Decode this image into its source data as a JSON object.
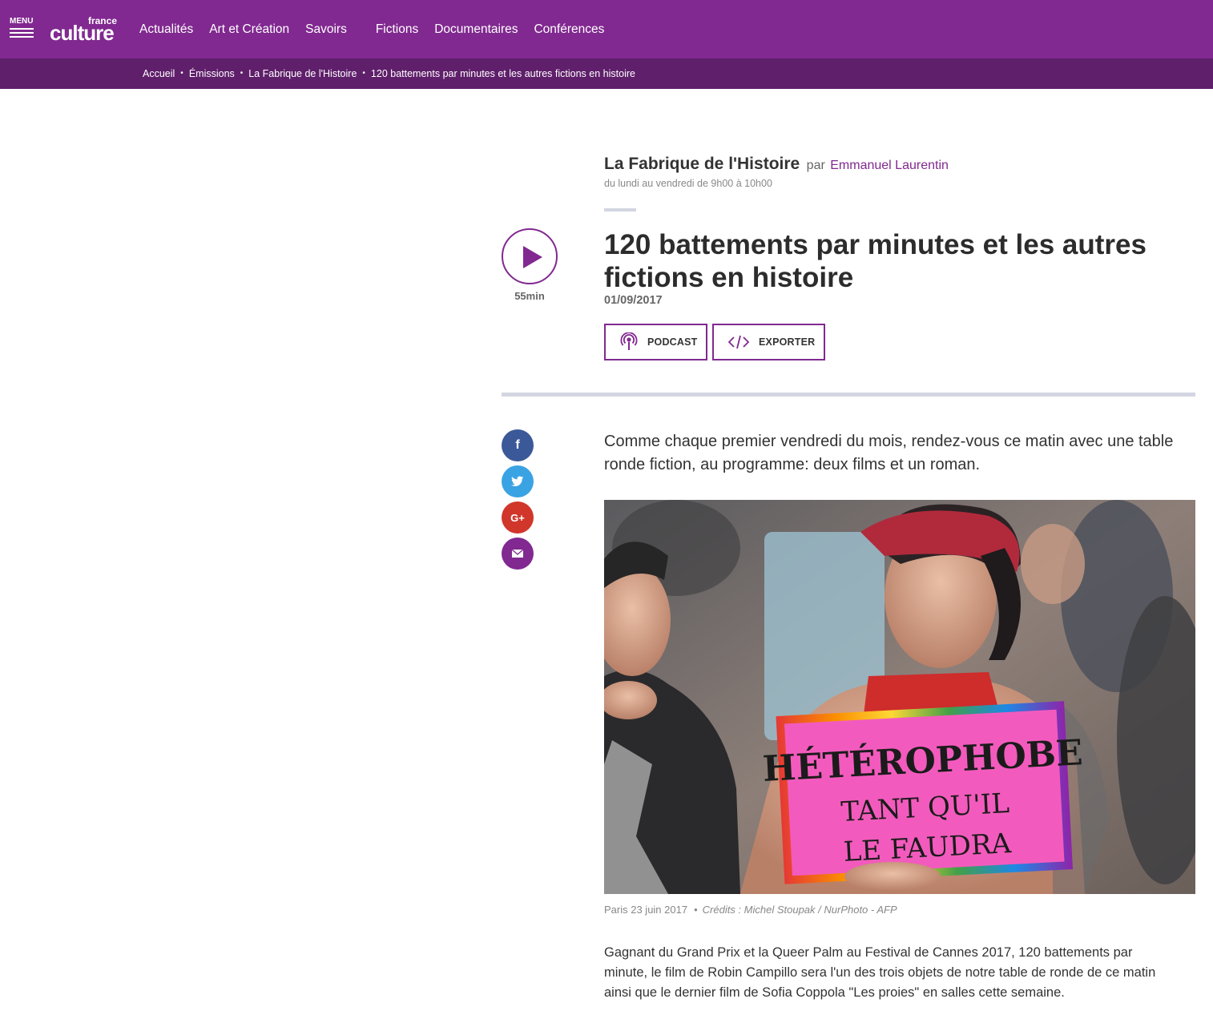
{
  "header": {
    "menu_label": "MENU",
    "logo_top": "france",
    "logo_main": "culture",
    "nav": [
      "Actualités",
      "Art et Création",
      "Savoirs",
      "Fictions",
      "Documentaires",
      "Conférences"
    ]
  },
  "breadcrumb": [
    "Accueil",
    "Émissions",
    "La Fabrique de l'Histoire",
    "120 battements par minutes et les autres fictions en histoire"
  ],
  "show": {
    "title": "La Fabrique de l'Histoire",
    "par": "par",
    "host": "Emmanuel Laurentin",
    "schedule": "du lundi au vendredi de 9h00 à 10h00"
  },
  "player": {
    "duration": "55min"
  },
  "article": {
    "title": "120 battements par minutes et les autres fictions en histoire",
    "date": "01/09/2017",
    "intro": "Comme chaque premier vendredi du mois, rendez-vous ce matin avec une table ronde fiction, au programme: deux films et un roman.",
    "image": {
      "sign_line1": "HÉTÉROPHOBE",
      "sign_line2": "TANT QU'IL",
      "sign_line3": "LE FAUDRA"
    },
    "caption": {
      "text": "Paris 23 juin 2017",
      "dot": "•",
      "credit": "Crédits : Michel Stoupak / NurPhoto - AFP"
    },
    "body": "Gagnant du Grand Prix et la Queer Palm au Festival de Cannes 2017, 120 battements par minute, le film de Robin Campillo sera l'un des trois objets de notre table de ronde de ce matin ainsi que le dernier film de Sofia Coppola \"Les proies\" en salles cette semaine."
  },
  "actions": {
    "podcast_label": "PODCAST",
    "export_label": "EXPORTER"
  },
  "share": {
    "facebook_glyph": "f",
    "gplus_glyph": "G+"
  },
  "colors": {
    "brand": "#812990",
    "brand_dark": "#5f1f6a",
    "facebook": "#3b5998",
    "twitter": "#3aa3e3",
    "gplus": "#d0362a"
  }
}
